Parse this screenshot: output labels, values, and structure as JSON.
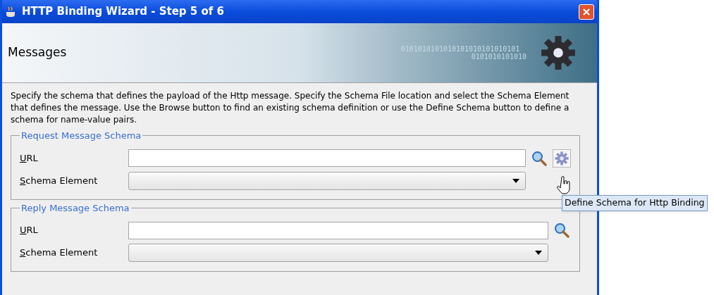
{
  "window": {
    "title": "HTTP Binding Wizard - Step 5 of 6"
  },
  "header": {
    "title": "Messages",
    "banner_text": "0101010101010101010101010101",
    "banner_text_2": "0101010101010"
  },
  "description": "Specify the schema that defines the payload of the Http message.  Specify the Schema File location and select the Schema Element that defines the message. Use the Browse button to find an existing schema definition or use the Define Schema button to define a schema for name-value pairs.",
  "groups": [
    {
      "title": "Request Message Schema",
      "url_label": "URL",
      "element_label": "Schema Element",
      "define_button": true
    },
    {
      "title": "Reply Message Schema",
      "url_label": "URL",
      "element_label": "Schema Element",
      "define_button": false
    }
  ],
  "tooltip": "Define Schema for Http Binding"
}
